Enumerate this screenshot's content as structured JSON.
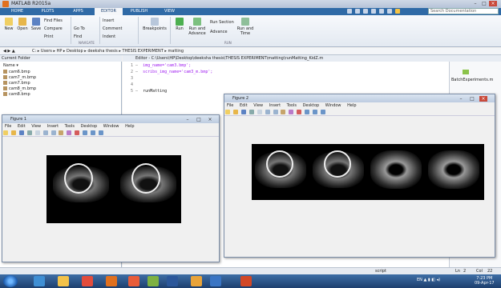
{
  "window": {
    "title": "MATLAB R2015a"
  },
  "tabs": [
    "HOME",
    "PLOTS",
    "APPS",
    "EDITOR",
    "PUBLISH",
    "VIEW"
  ],
  "active_tab": "EDITOR",
  "search": {
    "placeholder": "Search Documentation"
  },
  "ribbon": {
    "file": {
      "new": "New",
      "open": "Open",
      "save": "Save",
      "find_files": "Find Files",
      "compare": "Compare",
      "print": "Print"
    },
    "navigate": {
      "go_to": "Go To",
      "find": "Find",
      "group": "NAVIGATE"
    },
    "edit": {
      "insert": "Insert",
      "comment": "Comment",
      "indent": "Indent"
    },
    "breakpoints": {
      "label": "Breakpoints"
    },
    "run": {
      "run": "Run",
      "run_advance": "Run and Advance",
      "run_section": "Run Section",
      "advance": "Advance",
      "run_time": "Run and Time",
      "group": "RUN"
    }
  },
  "address": {
    "path": "C: ▸ Users ▸ HP ▸ Desktop ▸ deeksha thesis ▸ THESIS EXPERIMENT ▸ matting"
  },
  "current_folder": {
    "title": "Current Folder",
    "column": "Name",
    "files": [
      "cam6.bmp",
      "cam7_m.bmp",
      "cam7.bmp",
      "cam8_m.bmp",
      "cam8.bmp"
    ]
  },
  "editor": {
    "title": "Editor - C:\\Users\\HP\\Desktop\\deeksha thesis\\THESIS EXPERIMENT\\matting\\runMatting_KidZ.m",
    "lines": [
      {
        "num": "1 –",
        "code": "img_name='cam3.bmp';"
      },
      {
        "num": "2 –",
        "code": "scribs_img_name='cam3_m.bmp';"
      },
      {
        "num": "3",
        "code": ""
      },
      {
        "num": "4",
        "code": ""
      },
      {
        "num": "5 –",
        "code": "runMatting"
      }
    ]
  },
  "right_panel": {
    "item": "BatchExperiments.m"
  },
  "figure1": {
    "title": "Figure 1",
    "menu": [
      "File",
      "Edit",
      "View",
      "Insert",
      "Tools",
      "Desktop",
      "Window",
      "Help"
    ]
  },
  "figure2": {
    "title": "Figure 2",
    "menu": [
      "File",
      "Edit",
      "View",
      "Insert",
      "Tools",
      "Desktop",
      "Window",
      "Help"
    ]
  },
  "status": {
    "script": "script",
    "ln_label": "Ln",
    "ln": "2",
    "col_label": "Col",
    "col": "22"
  },
  "taskbar": {
    "time": "7:23 PM",
    "date": "09-Apr-17"
  }
}
